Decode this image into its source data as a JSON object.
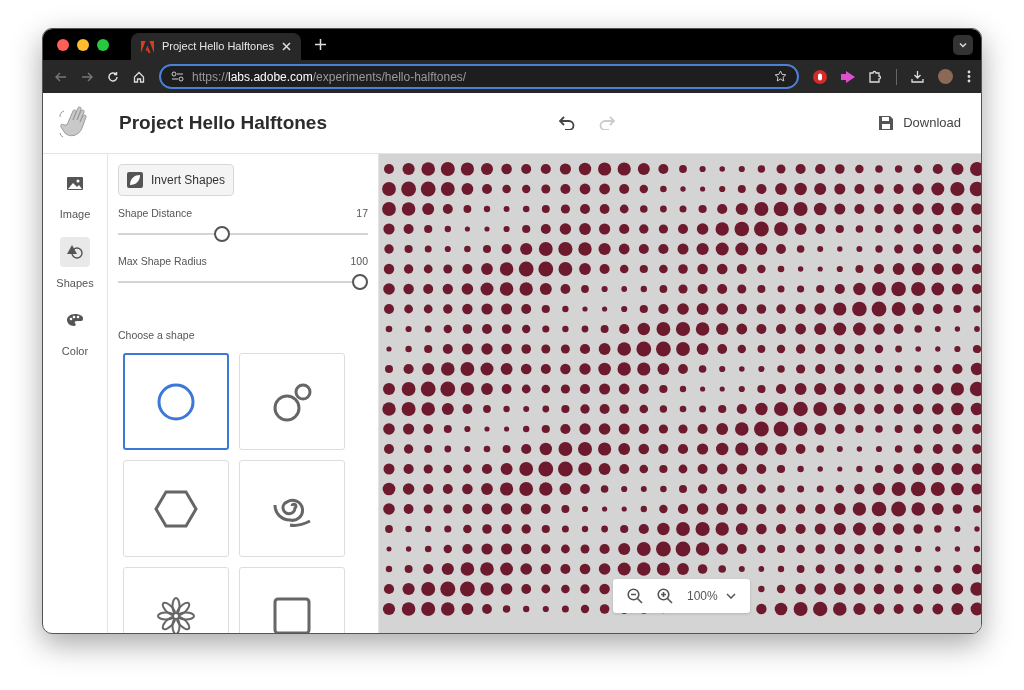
{
  "browser": {
    "tab_title": "Project Hello Halftones",
    "url_scheme": "https://",
    "url_host": "labs.adobe.com",
    "url_path": "/experiments/hello-halftones/"
  },
  "app": {
    "title": "Project Hello Halftones",
    "undo_disabled": false,
    "redo_disabled": true,
    "download_label": "Download"
  },
  "rail": [
    {
      "label": "Image",
      "kind": "image",
      "selected": false
    },
    {
      "label": "Shapes",
      "kind": "shapes",
      "selected": true
    },
    {
      "label": "Color",
      "kind": "palette",
      "selected": false
    }
  ],
  "invert_button": "Invert Shapes",
  "sliders": [
    {
      "label": "Shape Distance",
      "reading": "17",
      "level": 0.41
    },
    {
      "label": "Max Shape Radius",
      "reading": "100",
      "level": 1
    }
  ],
  "shape_heading": "Choose a shape",
  "shapes": [
    {
      "kind": "circle",
      "selected": true
    },
    {
      "kind": "bubbles",
      "selected": false
    },
    {
      "kind": "hexagon",
      "selected": false
    },
    {
      "kind": "spiral",
      "selected": false
    },
    {
      "kind": "flower",
      "selected": false
    },
    {
      "kind": "square",
      "selected": false
    }
  ],
  "zoom": {
    "reading": "100%"
  }
}
